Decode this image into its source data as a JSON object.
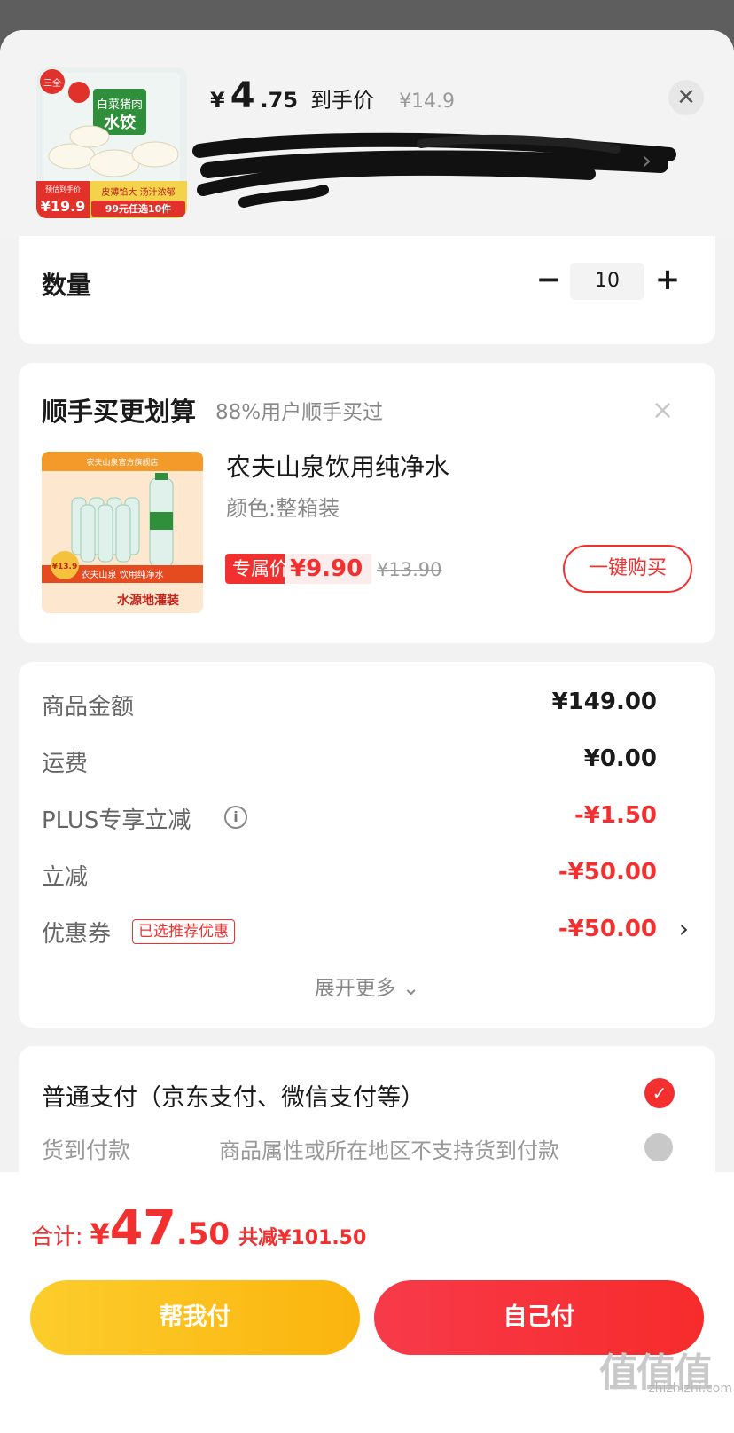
{
  "header": {
    "price_yen": "¥",
    "price_int": "4",
    "price_dec": ".75",
    "price_label": "到手价",
    "original_price": "¥14.9",
    "thumb": {
      "brand": "三全",
      "name_line1": "白菜猪肉",
      "name_line2": "水饺",
      "price_tag": "¥19.9",
      "price_tag_label": "预估到手价",
      "promo1": "皮薄馅大 汤汁浓郁",
      "promo2": "99元任选10件"
    }
  },
  "quantity": {
    "label": "数量",
    "minus": "−",
    "value": "10",
    "plus": "+"
  },
  "upsell": {
    "title": "顺手买更划算",
    "subtitle": "88%用户顺手买过",
    "close": "×",
    "product": {
      "name": "农夫山泉饮用纯净水",
      "spec": "颜色:整箱装",
      "tag_label": "专属价",
      "price": "¥9.90",
      "original_price": "¥13.90",
      "buy_label": "一键购买",
      "img_store": "农夫山泉官方旗舰店",
      "img_title": "农夫山泉 饮用纯净水",
      "img_sub": "水源地灌装",
      "img_price": "¥13.9"
    }
  },
  "summary": {
    "rows": [
      {
        "label": "商品金额",
        "value": "¥149.00"
      },
      {
        "label": "运费",
        "value": "¥0.00"
      },
      {
        "label": "PLUS专享立减",
        "value": "-¥1.50"
      },
      {
        "label": "立减",
        "value": "-¥50.00"
      },
      {
        "label": "优惠券",
        "value": "-¥50.00",
        "badge": "已选推荐优惠"
      }
    ],
    "more": "展开更多 ⌄"
  },
  "payment": {
    "option1": "普通支付（京东支付、微信支付等）",
    "option2": "货到付款",
    "option2_note": "商品属性或所在地区不支持货到付款"
  },
  "footer": {
    "total_label": "合计:",
    "total_yen": "¥",
    "total_int": "47",
    "total_dec": ".50",
    "saved": "共减¥101.50",
    "help_pay": "帮我付",
    "self_pay": "自己付",
    "watermark": "zhizhizhi.com",
    "watermark_glyphs": "值值值"
  },
  "colors": {
    "accent_red": "#f23030",
    "help_yellow": "#fbb40e"
  }
}
